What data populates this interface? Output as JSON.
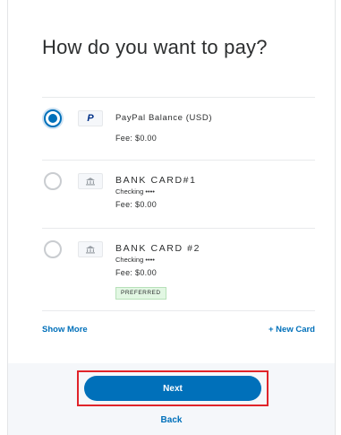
{
  "title": "How do you want to pay?",
  "options": [
    {
      "name": "PayPal Balance (USD)",
      "icon": "paypal-logo-icon",
      "account": "",
      "fee": "Fee: $0.00",
      "badge": "",
      "selected": true
    },
    {
      "name": "BANK CARD#1",
      "icon": "bank-icon",
      "account": "Checking ••••",
      "fee": "Fee: $0.00",
      "badge": "",
      "selected": false
    },
    {
      "name": "BANK CARD #2",
      "icon": "bank-icon",
      "account": "Checking ••••",
      "fee": "Fee: $0.00",
      "badge": "PREFERRED",
      "selected": false
    }
  ],
  "links": {
    "show_more": "Show More",
    "new_card": "+ New Card"
  },
  "footer": {
    "next_label": "Next",
    "back_label": "Back",
    "highlight_color": "#e0242a"
  },
  "colors": {
    "accent": "#0070ba",
    "paypal_dark": "#003087",
    "badge_bg": "#e2f7e3"
  }
}
